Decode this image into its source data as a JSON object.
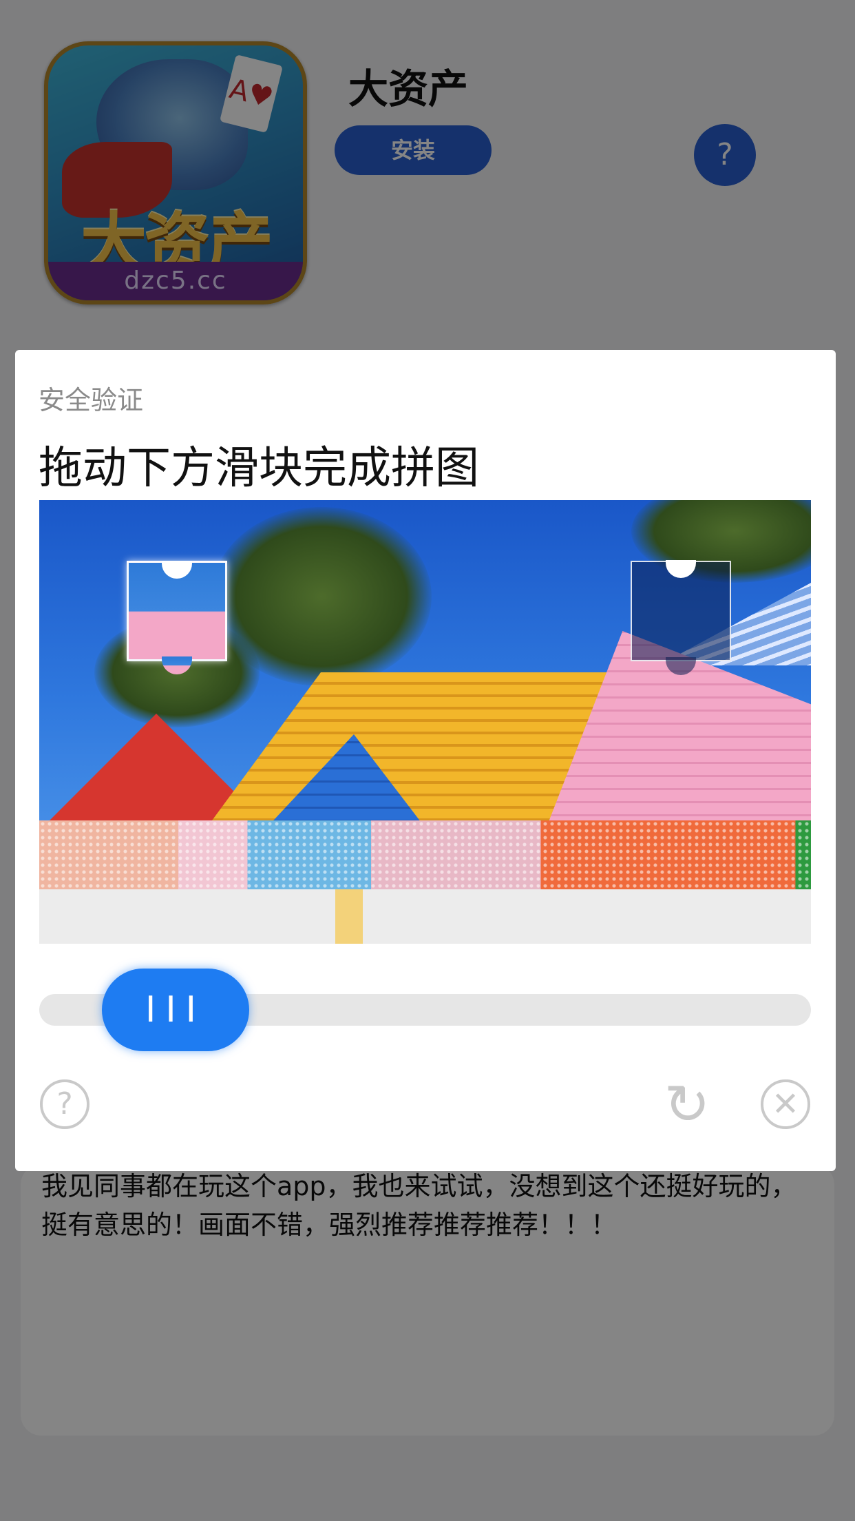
{
  "app": {
    "name": "大资产",
    "install_label": "安装",
    "help_label": "?",
    "icon": {
      "brand_text": "大资产",
      "domain_text": "dzc5.cc",
      "card_text": "A♥"
    }
  },
  "review": {
    "text": "我见同事都在玩这个app，我也来试试，没想到这个还挺好玩的，挺有意思的！画面不错，强烈推荐推荐推荐！！！"
  },
  "captcha": {
    "subtitle": "安全验证",
    "title": "拖动下方滑块完成拼图",
    "slider_handle_glyph": "III",
    "slider_progress": 0.08,
    "icons": {
      "help": "help-circle-icon",
      "refresh": "refresh-icon",
      "close": "close-circle-icon"
    },
    "icon_glyphs": {
      "help": "?",
      "refresh": "↻",
      "close": "✕"
    },
    "colors": {
      "accent": "#1e7cf2",
      "track": "#e6e6e6",
      "muted_icon": "#c9c9c9"
    }
  }
}
